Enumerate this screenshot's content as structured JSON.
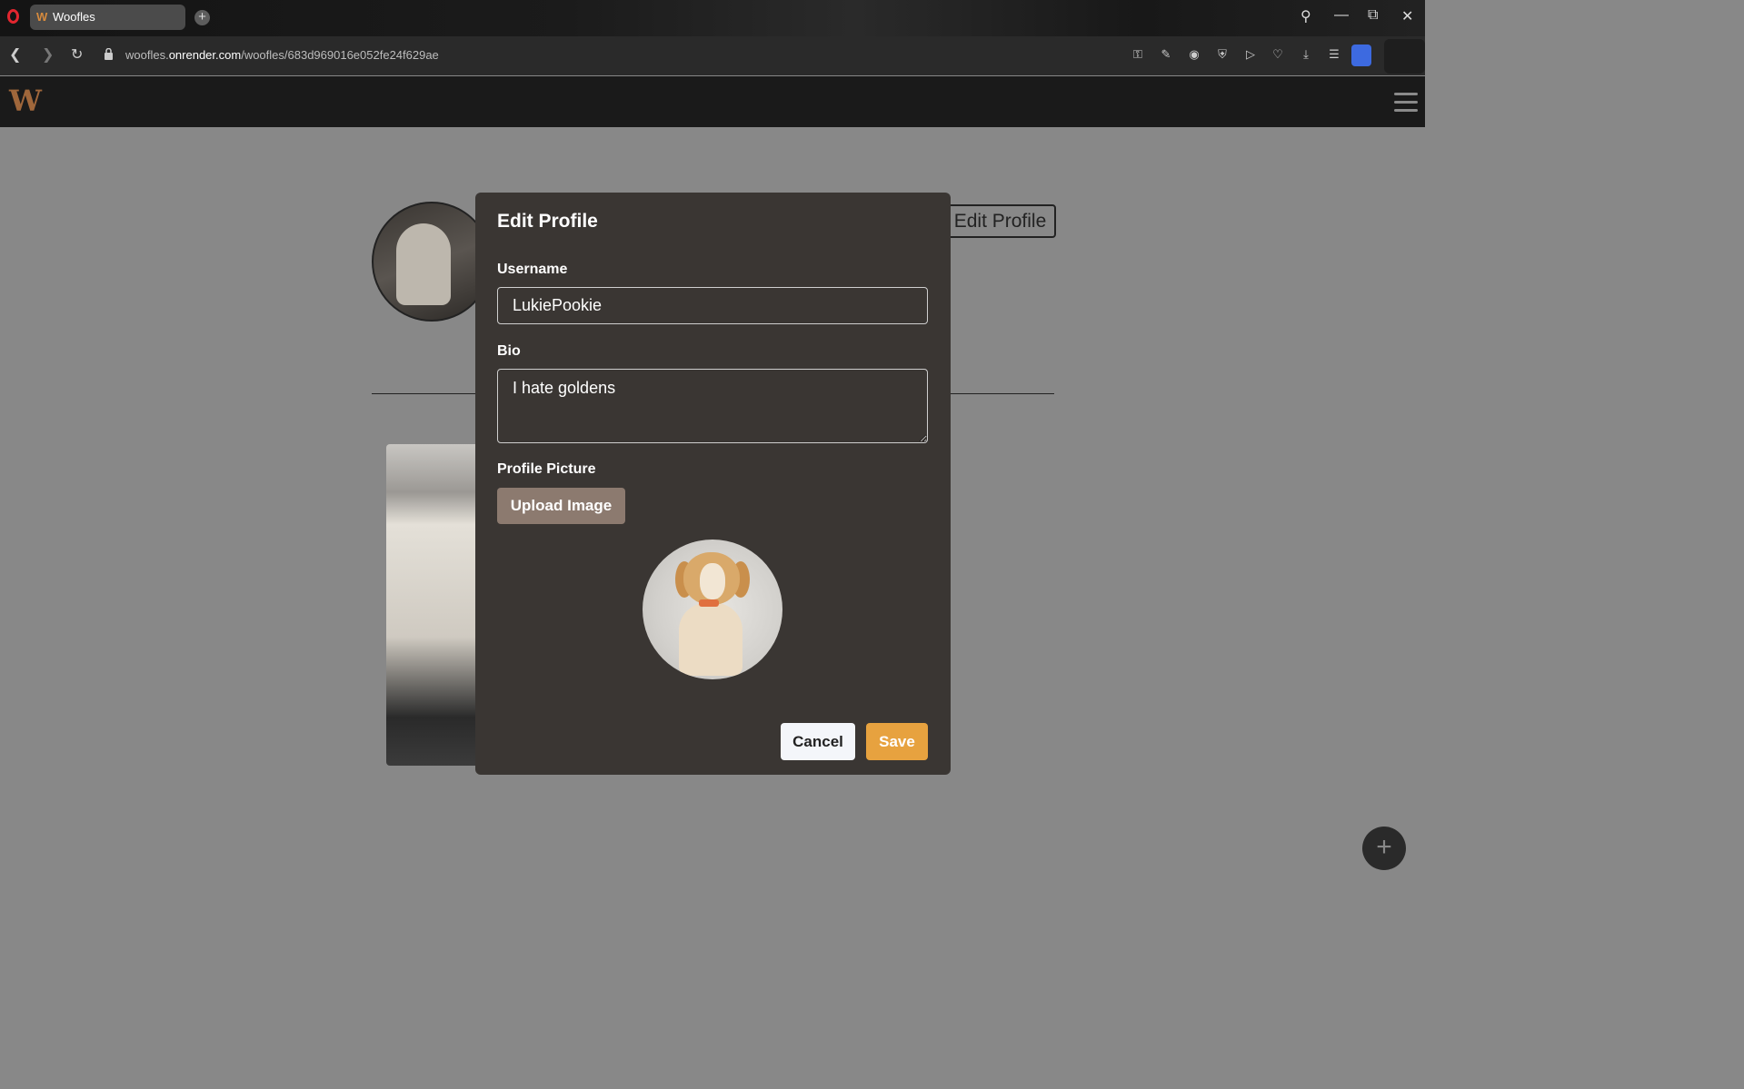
{
  "browser": {
    "tab_title": "Woofles",
    "tab_favicon": "W",
    "url_domain_prefix": "woofles.",
    "url_domain": "onrender.com",
    "url_path": "/woofles/683d969016e052fe24f629ae",
    "icons": [
      "back-icon",
      "forward-icon",
      "reload-icon",
      "lock-icon",
      "search-icon",
      "minimize-icon",
      "restore-icon",
      "close-icon",
      "key-icon",
      "edit-icon",
      "camera-icon",
      "shield-icon",
      "send-icon",
      "heart-icon",
      "download-icon",
      "menu-icon",
      "profile-icon",
      "cube-icon"
    ]
  },
  "app": {
    "logo": "W"
  },
  "profile_page": {
    "edit_profile_label": "Edit Profile"
  },
  "modal": {
    "title": "Edit Profile",
    "username_label": "Username",
    "username_value": "LukiePookie",
    "bio_label": "Bio",
    "bio_value": "I hate goldens",
    "picture_label": "Profile Picture",
    "upload_label": "Upload Image",
    "cancel_label": "Cancel",
    "save_label": "Save"
  },
  "colors": {
    "modal_bg": "#3a3633",
    "save_accent": "#e7a23f",
    "upload_bg": "#8c7a6f",
    "overlay": "#888888"
  }
}
